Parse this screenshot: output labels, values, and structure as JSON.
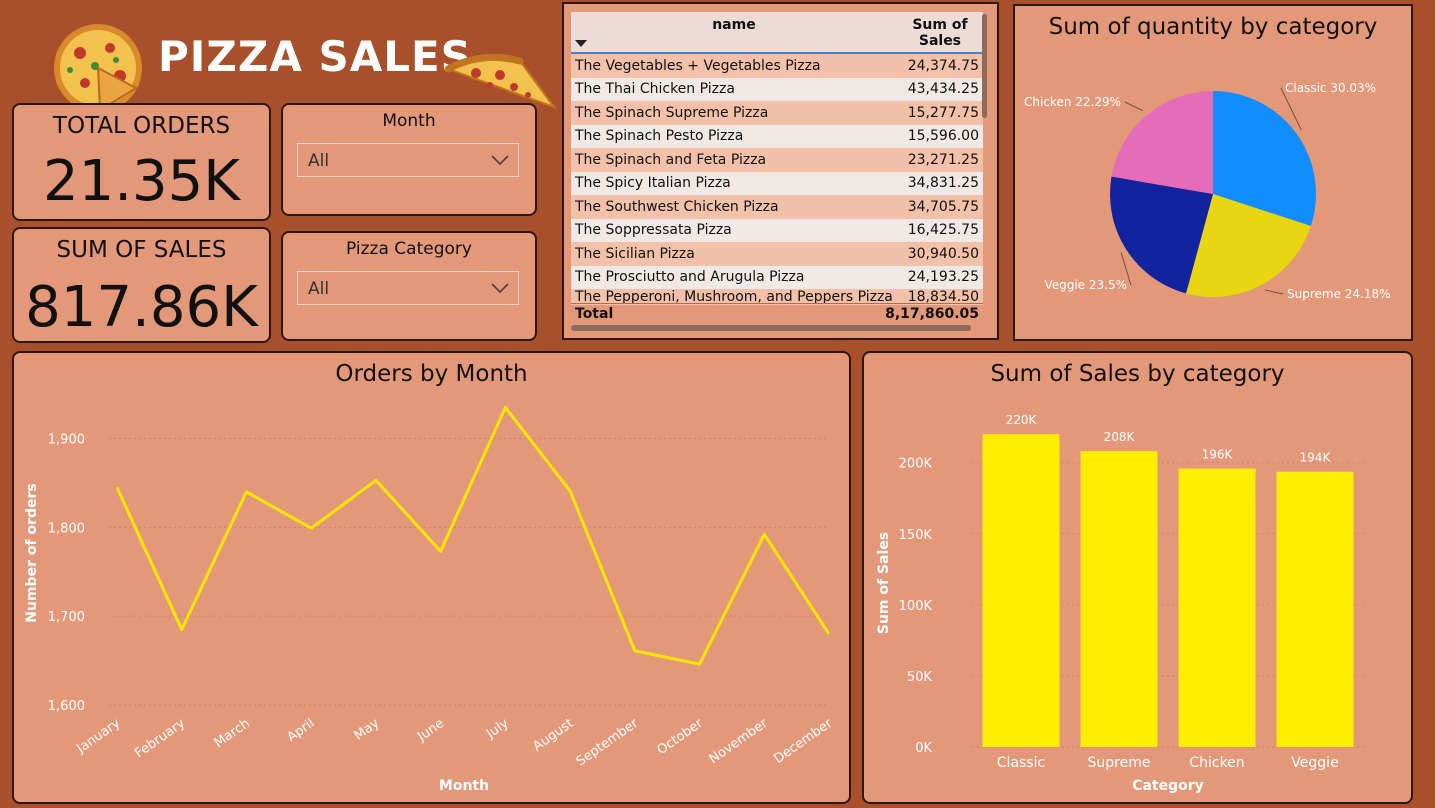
{
  "header": {
    "title": "PIZZA SALES"
  },
  "kpis": {
    "total_orders_label": "TOTAL ORDERS",
    "total_orders_value": "21.35K",
    "sum_sales_label": "SUM OF SALES",
    "sum_sales_value": "817.86K"
  },
  "slicers": {
    "month_label": "Month",
    "month_value": "All",
    "category_label": "Pizza Category",
    "category_value": "All"
  },
  "table": {
    "col_name": "name",
    "col_sales": "Sum of Sales",
    "rows": [
      {
        "name": "The Vegetables + Vegetables Pizza",
        "sales": "24,374.75"
      },
      {
        "name": "The Thai Chicken Pizza",
        "sales": "43,434.25"
      },
      {
        "name": "The Spinach Supreme Pizza",
        "sales": "15,277.75"
      },
      {
        "name": "The Spinach Pesto Pizza",
        "sales": "15,596.00"
      },
      {
        "name": "The Spinach and Feta Pizza",
        "sales": "23,271.25"
      },
      {
        "name": "The Spicy Italian Pizza",
        "sales": "34,831.25"
      },
      {
        "name": "The Southwest Chicken Pizza",
        "sales": "34,705.75"
      },
      {
        "name": "The Soppressata Pizza",
        "sales": "16,425.75"
      },
      {
        "name": "The Sicilian Pizza",
        "sales": "30,940.50"
      },
      {
        "name": "The Prosciutto and Arugula Pizza",
        "sales": "24,193.25"
      },
      {
        "name": "The Pepperoni, Mushroom, and Peppers Pizza",
        "sales": "18,834.50"
      }
    ],
    "total_label": "Total",
    "total_value": "8,17,860.05"
  },
  "colors": {
    "background": "#a84f2b",
    "card": "#e4987a",
    "line": "#ffe600",
    "bar": "#ffee00",
    "classic": "#118dff",
    "supreme": "#e8d610",
    "veggie": "#12239e",
    "chicken": "#e66cba"
  },
  "chart_data": [
    {
      "type": "pie",
      "title": "Sum of quantity by category",
      "categories": [
        "Classic",
        "Supreme",
        "Veggie",
        "Chicken"
      ],
      "values": [
        30.03,
        24.18,
        23.5,
        22.29
      ],
      "labels": [
        "Classic 30.03%",
        "Supreme 24.18%",
        "Veggie 23.5%",
        "Chicken 22.29%"
      ]
    },
    {
      "type": "line",
      "title": "Orders by Month",
      "xlabel": "Month",
      "ylabel": "Number of orders",
      "categories": [
        "January",
        "February",
        "March",
        "April",
        "May",
        "June",
        "July",
        "August",
        "September",
        "October",
        "November",
        "December"
      ],
      "values": [
        1845,
        1685,
        1840,
        1799,
        1853,
        1773,
        1935,
        1841,
        1661,
        1646,
        1792,
        1680
      ],
      "yticks": [
        "1,600",
        "1,700",
        "1,800",
        "1,900"
      ],
      "ylim": [
        1600,
        1940
      ],
      "grid": true
    },
    {
      "type": "bar",
      "title": "Sum of Sales by category",
      "xlabel": "Category",
      "ylabel": "Sum of Sales",
      "categories": [
        "Classic",
        "Supreme",
        "Chicken",
        "Veggie"
      ],
      "values": [
        220053,
        208197,
        195920,
        193690
      ],
      "data_labels": [
        "220K",
        "208K",
        "196K",
        "194K"
      ],
      "yticks": [
        "0K",
        "50K",
        "100K",
        "150K",
        "200K"
      ],
      "ylim": [
        0,
        235000
      ],
      "grid": true
    }
  ]
}
